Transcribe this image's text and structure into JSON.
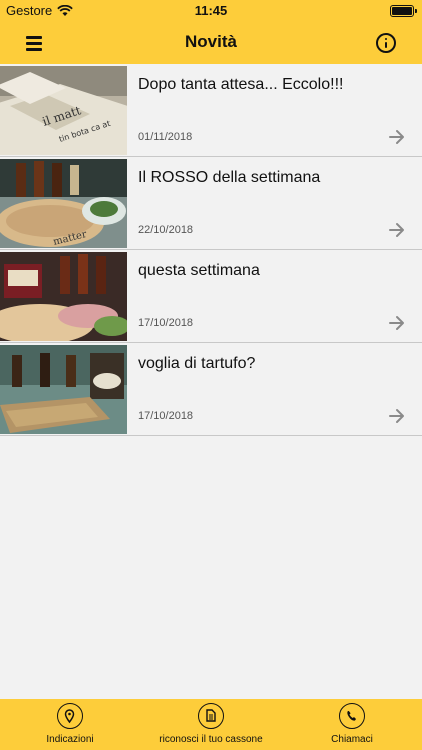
{
  "status_bar": {
    "carrier": "Gestore",
    "time": "11:45"
  },
  "header": {
    "title": "Novità",
    "menu_icon": "hamburger-icon",
    "info_icon": "info-icon"
  },
  "news": [
    {
      "title": "Dopo tanta attesa... Eccolo!!!",
      "date": "01/11/2018"
    },
    {
      "title": "Il ROSSO della settimana",
      "date": "22/10/2018"
    },
    {
      "title": "questa settimana",
      "date": "17/10/2018"
    },
    {
      "title": "voglia di tartufo?",
      "date": "17/10/2018"
    }
  ],
  "tabs": [
    {
      "label": "Indicazioni",
      "icon": "location-pin-icon"
    },
    {
      "label": "riconosci il tuo cassone",
      "icon": "document-icon"
    },
    {
      "label": "Chiamaci",
      "icon": "phone-icon"
    }
  ],
  "colors": {
    "accent": "#fdcd3a",
    "background": "#f2f2f2",
    "divider": "#c8c8c8"
  }
}
